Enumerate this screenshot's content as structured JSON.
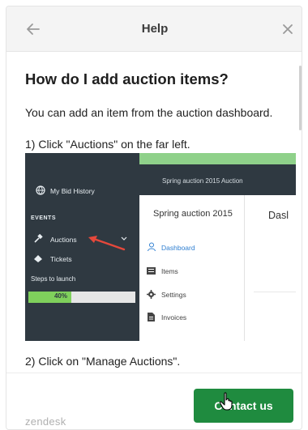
{
  "header": {
    "title": "Help",
    "back_icon": "arrow-left-icon",
    "close_icon": "close-icon"
  },
  "article": {
    "title": "How do I add auction items?",
    "paragraph1": "You can add an item from the auction dashboard.",
    "step1": "1) Click \"Auctions\" on the far left.",
    "step2": "2) Click on \"Manage Auctions\"."
  },
  "screenshot": {
    "sidebar": {
      "history": "My Bid History",
      "section": "EVENTS",
      "auctions": "Auctions",
      "tickets": "Tickets",
      "steps": "Steps to launch",
      "progress_label": "40%",
      "progress_value": 0.4
    },
    "topbar": "Spring auction 2015 Auction",
    "panel": {
      "title": "Spring auction 2015",
      "items": [
        "Dashboard",
        "Items",
        "Settings",
        "Invoices"
      ]
    },
    "right_title": "Dasl",
    "colors": {
      "sidebar": "#2f3941",
      "accent_green": "#7fd05c",
      "arrow": "#e5483b"
    }
  },
  "footer": {
    "brand": "zendesk",
    "contact_label": "Contact us",
    "button_color": "#1f8b3f"
  }
}
